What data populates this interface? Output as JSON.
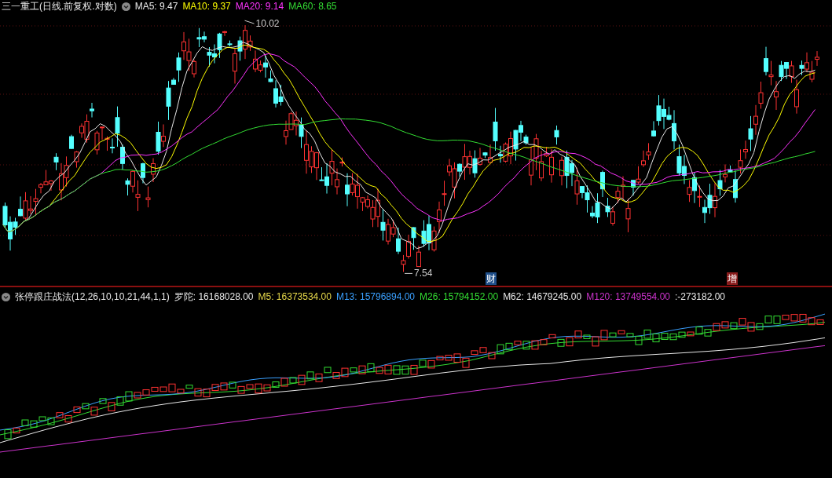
{
  "price_panel": {
    "title": "三一重工(日线.前复权.对数)",
    "legend": [
      {
        "name": "MA5:",
        "value": "9.47",
        "color": "#e8e8e8"
      },
      {
        "name": "MA10:",
        "value": "9.37",
        "color": "#ffff00"
      },
      {
        "name": "MA20:",
        "value": "9.14",
        "color": "#ff33ff"
      },
      {
        "name": "MA60:",
        "value": "8.65",
        "color": "#33dd33"
      }
    ],
    "high_label": "10.02",
    "low_label": "7.54",
    "events": [
      {
        "label": "财",
        "color": "#1f4f8a"
      },
      {
        "label": "增",
        "color": "#8a1c1c"
      }
    ]
  },
  "indicator_panel": {
    "title": "张停跟庄战法(12,26,10,10,21,44,1,1)",
    "legend": [
      {
        "name": "罗陀:",
        "value": "16168028.00",
        "color": "#e8e8e8"
      },
      {
        "name": "M5:",
        "value": "16373534.00",
        "color": "#e6d84a"
      },
      {
        "name": "M13:",
        "value": "15796894.00",
        "color": "#3aa0ff"
      },
      {
        "name": "M26:",
        "value": "15794152.00",
        "color": "#33dd33"
      },
      {
        "name": "M62:",
        "value": "14679245.00",
        "color": "#e8e8e8"
      },
      {
        "name": "M120:",
        "value": "13749554.00",
        "color": "#cc33cc"
      },
      {
        "value": ":-273182.00",
        "color": "#e8e8e8"
      }
    ]
  }
}
